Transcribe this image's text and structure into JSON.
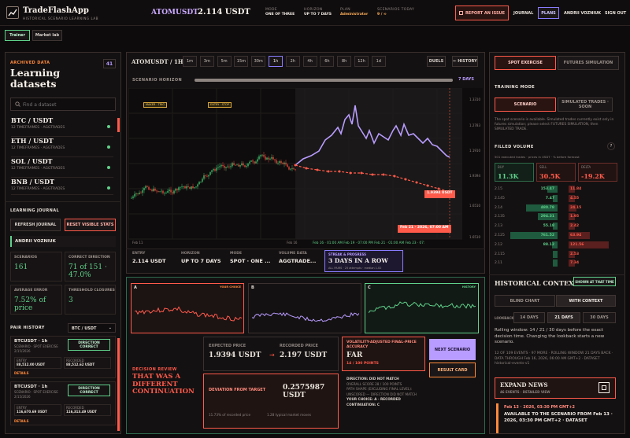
{
  "app": {
    "name": "TradeFlashApp",
    "tagline": "HISTORICAL SCENARIO LEARNING LAB"
  },
  "topbar": {
    "symbol": "ATOMUSDT",
    "price": "2.114 USDT",
    "stats": [
      {
        "k": "MODE",
        "v": "ONE OF THREE"
      },
      {
        "k": "HORIZON",
        "v": "UP TO 7 DAYS"
      },
      {
        "k": "PLAN",
        "v": "Administrator"
      },
      {
        "k": "SCENARIOS TODAY",
        "v": "9 / ∞"
      }
    ],
    "report_label": "REPORT AN ISSUE",
    "nav": [
      "JOURNAL",
      "PLANS",
      "ANDRII VOZNIUK",
      "SIGN OUT"
    ]
  },
  "subtabs": [
    "Trainer",
    "Market lab"
  ],
  "left": {
    "archived_label": "ARCHIVED DATA",
    "title": "Learning datasets",
    "count": "41",
    "search_placeholder": "Find a dataset",
    "datasets": [
      {
        "name": "BTC / USDT",
        "sub": "12 TIMEFRAMES · AGGTRADES"
      },
      {
        "name": "ETH / USDT",
        "sub": "12 TIMEFRAMES · AGGTRADES"
      },
      {
        "name": "SOL / USDT",
        "sub": "12 TIMEFRAMES · AGGTRADES"
      },
      {
        "name": "BNB / USDT",
        "sub": "12 TIMEFRAMES · AGGTRADES"
      }
    ],
    "journal_label": "LEARNING JOURNAL",
    "refresh_label": "REFRESH JOURNAL",
    "reset_label": "RESET VISIBLE STATS",
    "user": "ANDRII VOZNIUK",
    "metrics": [
      {
        "k": "SCENARIOS",
        "v": "161"
      },
      {
        "k": "CORRECT DIRECTION",
        "v": "71 of 151 · 47.0%"
      },
      {
        "k": "AVERAGE ERROR",
        "v": "7.52% of price"
      },
      {
        "k": "THRESHOLD CLOSURES",
        "v": "3"
      }
    ],
    "pair_history_label": "PAIR HISTORY",
    "pair_select": "BTC / USDT",
    "history": [
      {
        "pair": "BTCUSDT · 1h",
        "sub": "SCENARIO · SPOT EXERCISE",
        "date": "2/15/2026",
        "badge": "DIRECTION CORRECT",
        "k1": "ENTRY",
        "v1": "88,512.00 USDT",
        "k2": "RECORDED",
        "v2": "88,512.62 USDT",
        "details": "DETAILS"
      },
      {
        "pair": "BTCUSDT · 1h",
        "sub": "SCENARIO · SPOT EXERCISE",
        "date": "2/15/2026",
        "badge": "DIRECTION CORRECT",
        "k1": "ENTRY",
        "v1": "116,670.69 USDT",
        "k2": "RECORDED",
        "v2": "116,313.49 USDT",
        "details": "DETAILS"
      }
    ]
  },
  "chart_header": {
    "pair": "ATOMUSDT / 1H",
    "timeframes": [
      "1m",
      "3m",
      "5m",
      "15m",
      "30m",
      "1h",
      "2h",
      "4h",
      "6h",
      "8h",
      "12h",
      "1d"
    ],
    "active_tf": "1h",
    "duels": "DUELS",
    "history": "← HISTORY",
    "horizon_label": "SCENARIO HORIZON",
    "horizon_value": "7 DAYS",
    "horizon_fraction": 1.0
  },
  "chart_data": {
    "type": "line",
    "y_ticks": [
      "1.3310",
      "1.2783",
      "1.1910",
      "1.9394",
      "1.6510",
      "1.6510",
      "1.6510"
    ],
    "x_ticks": [
      "Feb 11",
      "Feb 16"
    ],
    "time_stamp": "Feb 21 · 2026, 07:00 AM",
    "range_caption": "Feb 16 · 01:00 AM  Feb 19 · 07:00 PM  Feb 21 · 01:00 AM  Feb 23 · 07:",
    "prediction_label": "1.9394 USDT",
    "markers": [
      "MAKER · TRIG",
      "ENTRY · STOP"
    ]
  },
  "info_strip": [
    {
      "k": "ENTRY",
      "v": "2.114 USDT"
    },
    {
      "k": "HORIZON",
      "v": "UP TO 7 DAYS"
    },
    {
      "k": "MODE",
      "v": "SPOT · ONE ..."
    },
    {
      "k": "VOLUME DATA",
      "v": "AGGTRADE..."
    }
  ],
  "streak": {
    "k": "STREAK & PROGRESS",
    "v": "3 DAYS IN A ROW",
    "s": "ALL PAIRS · 25 attempts · median 1.02"
  },
  "replay": {
    "labels": [
      "A",
      "B",
      "C"
    ],
    "tags": [
      "YOUR CHOICE",
      "",
      "HISTORY"
    ],
    "review_label": "DECISION REVIEW",
    "review_title": "THAT WAS A DIFFERENT CONTINUATION",
    "expected_k": "EXPECTED PRICE",
    "expected_v": "1.9394 USDT",
    "recorded_k": "RECORDED PRICE",
    "recorded_v": "2.197 USDT",
    "deviation_k": "DEVIATION FROM TARGET",
    "deviation_v": "0.2575987 USDT",
    "deviation_pct": "11.73% of recorded price",
    "typical": "1.28 typical market moves",
    "accuracy_k": "VOLATILITY-ADJUSTED FINAL-PRICE ACCURACY",
    "accuracy_v": "FAR",
    "accuracy_pts": "14 / 100 POINTS",
    "summary": [
      "DIRECTION: DID NOT MATCH",
      "OVERALL SCORE 28 / 100 POINTS",
      "PATH SHAPE (EXCLUDING FINAL LEVEL): UNSCORED — DIRECTION DID NOT MATCH",
      "YOUR CHOICE: A · RECORDED CONTINUATION: C"
    ],
    "next_label": "NEXT SCENARIO",
    "card_label": "RESULT CARD"
  },
  "right": {
    "tabs": [
      "SPOT EXERCISE",
      "FUTURES SIMULATION"
    ],
    "training_label": "TRAINING MODE",
    "mode_tabs": [
      "SCENARIO",
      "SIMULATED TRADES · SOON"
    ],
    "training_desc": "The spot scenario is available. Simulated trades currently exist only in futures simulation; please select FUTURES SIMULATION, then SIMULATED TRADE.",
    "filled_label": "FILLED VOLUME",
    "filled_sub": "501 executed trades · prices in USDT · % before forecast",
    "vol_cards": [
      {
        "k": "BUY",
        "v": "11.3K"
      },
      {
        "k": "SELL",
        "v": "30.5K"
      },
      {
        "k": "DELTA",
        "v": "-19.2K"
      }
    ],
    "orderbook": [
      [
        "2.15",
        "153.47",
        "11.84"
      ],
      [
        "2.145",
        "7.47",
        "4.55"
      ],
      [
        "2.14",
        "480.78",
        "24.15"
      ],
      [
        "2.135",
        "294.31",
        "1.95"
      ],
      [
        "2.13",
        "55.18",
        "2.42"
      ],
      [
        "2.125",
        "761.52",
        "63.94"
      ],
      [
        "2.12",
        "88.12",
        "121.56"
      ],
      [
        "2.115",
        "",
        "2.53"
      ],
      [
        "2.11",
        "",
        "7.34"
      ]
    ],
    "context_label": "HISTORICAL CONTEXT",
    "context_btn": "SHOWN AT THAT TIME",
    "ctx_tabs": [
      "BLIND CHART",
      "WITH CONTEXT"
    ],
    "lookback_label": "LOOKBACK",
    "lookback": [
      "14 DAYS",
      "21 DAYS",
      "30 DAYS"
    ],
    "ctx_text": "Rolling window: 14 / 21 / 30 days before the exact decision time. Changing the lookback starts a new scenario.",
    "ctx_meta": "12 OF 109 EVENTS · 97 MORE · ROLLING WINDOW 21 DAYS BACK · DATA THROUGH Feb 16, 2026, 06:00 AM GMT+2 · DATASET historical-events-v1",
    "expand_label": "EXPAND NEWS",
    "expand_sub": "46 EVENTS · DETAILED VIEW",
    "event_date": "Feb 13 · 2026, 03:30 PM GMT+2",
    "event_text": "AVAILABLE TO THE SCENARIO FROM Feb 13 · 2026, 03:30 PM GMT+2 · DATASET"
  },
  "colors": {
    "accent": "#ff5a4a",
    "green": "#5fd18a",
    "purple": "#b89cff",
    "orange": "#ff8a3c"
  }
}
